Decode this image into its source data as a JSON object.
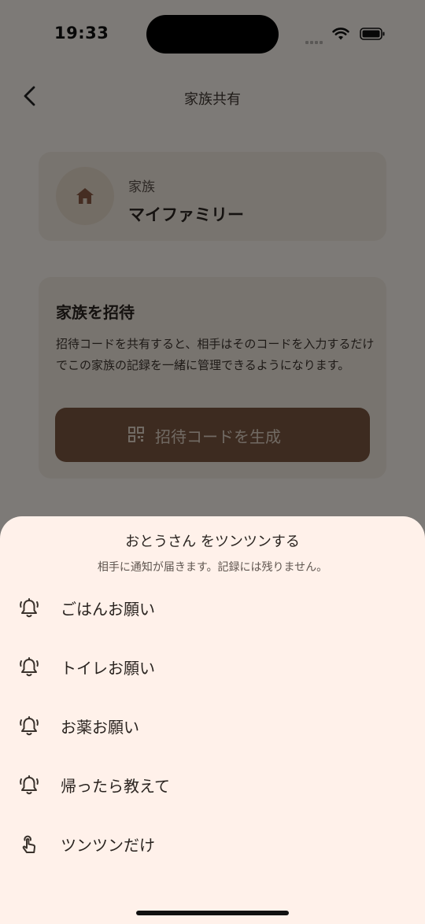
{
  "status_bar": {
    "time": "19:33"
  },
  "nav": {
    "title": "家族共有"
  },
  "family_card": {
    "label": "家族",
    "name": "マイファミリー"
  },
  "invite_card": {
    "title": "家族を招待",
    "description": "招待コードを共有すると、相手はそのコードを入力するだけでこの家族の記録を一緒に管理できるようになります。",
    "button_label": "招待コードを生成"
  },
  "sheet": {
    "title": "おとうさん をツンツンする",
    "subtitle": "相手に通知が届きます。記録には残りません。",
    "options": [
      {
        "label": "ごはんお願い",
        "icon": "bell-alert-icon"
      },
      {
        "label": "トイレお願い",
        "icon": "bell-alert-icon"
      },
      {
        "label": "お薬お願い",
        "icon": "bell-alert-icon"
      },
      {
        "label": "帰ったら教えて",
        "icon": "bell-alert-icon"
      },
      {
        "label": "ツンツンだけ",
        "icon": "tap-finger-icon"
      }
    ]
  },
  "colors": {
    "sheet_background": "#fff1ea",
    "button_brown": "#7a5640",
    "accent_home": "#8a5a44"
  }
}
